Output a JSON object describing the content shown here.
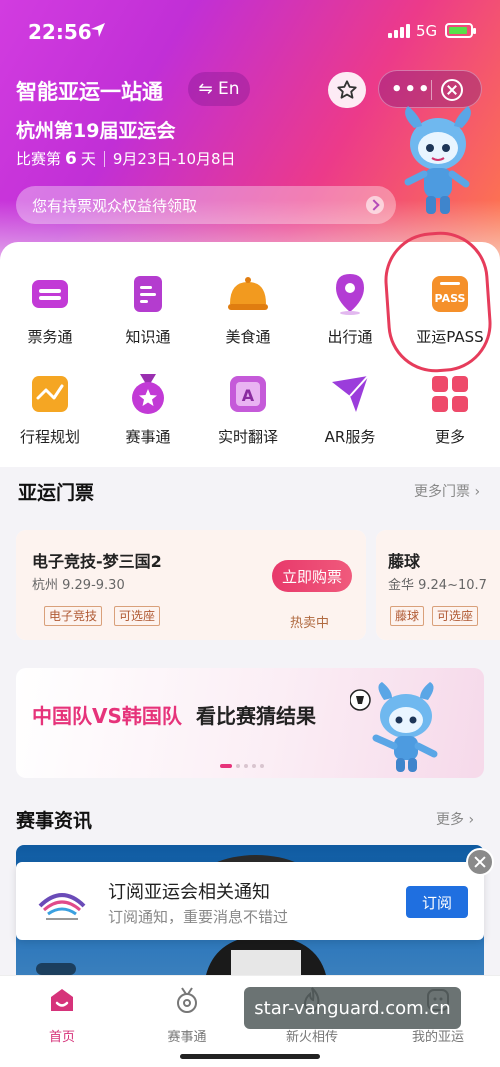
{
  "status_bar": {
    "time": "22:56",
    "network": "5G"
  },
  "header": {
    "app_title": "智能亚运一站通",
    "lang_label": "⇋ En",
    "games_title": "杭州第19届亚运会",
    "day_prefix": "比赛第",
    "day_number": "6",
    "day_suffix": "天",
    "dates": "9月23日-10月8日",
    "notice": "您有持票观众权益待领取"
  },
  "grid": [
    {
      "label": "票务通",
      "icon": "ticket-icon",
      "color": "#c23ad6"
    },
    {
      "label": "知识通",
      "icon": "document-icon",
      "color": "#b43ccf"
    },
    {
      "label": "美食通",
      "icon": "food-cover-icon",
      "color": "#f29a1f"
    },
    {
      "label": "出行通",
      "icon": "location-pin-icon",
      "color": "#b33cd4"
    },
    {
      "label": "亚运PASS",
      "icon": "pass-card-icon",
      "color": "#f5902a",
      "icon_text": "PASS"
    },
    {
      "label": "行程规划",
      "icon": "trip-chart-icon",
      "color": "#f5a623"
    },
    {
      "label": "赛事通",
      "icon": "medal-icon",
      "color": "#c23ad6"
    },
    {
      "label": "实时翻译",
      "icon": "translate-icon",
      "color": "#c55ad9",
      "icon_text": "A"
    },
    {
      "label": "AR服务",
      "icon": "ar-arrow-icon",
      "color": "#9b3ddb"
    },
    {
      "label": "更多",
      "icon": "more-grid-icon",
      "color": "#ee4a6a"
    }
  ],
  "tickets_section": {
    "title": "亚运门票",
    "more": "更多门票"
  },
  "tickets": [
    {
      "name": "电子竞技-梦三国2",
      "info": "杭州 9.29-9.30",
      "tags": [
        "电子竞技",
        "可选座"
      ],
      "buy_label": "立即购票",
      "status": "热卖中"
    },
    {
      "name": "藤球",
      "info": "金华 9.24~10.7",
      "tags": [
        "藤球",
        "可选座"
      ]
    }
  ],
  "banner": {
    "red_text": "中国队VS韩国队",
    "black_text": "看比赛猜结果"
  },
  "news_section": {
    "title": "赛事资讯",
    "more": "更多"
  },
  "subscribe": {
    "title": "订阅亚运会相关通知",
    "desc": "订阅通知，重要消息不错过",
    "button": "订阅"
  },
  "tabs": [
    {
      "label": "首页",
      "icon": "home-icon",
      "active": true
    },
    {
      "label": "赛事通",
      "icon": "medal-tab-icon"
    },
    {
      "label": "新火相传",
      "icon": "flame-icon"
    },
    {
      "label": "我的亚运",
      "icon": "profile-icon"
    }
  ],
  "watermark": "star-vanguard.com.cn",
  "colors": {
    "accent": "#e6337a",
    "brand_purple": "#c23ad6",
    "subscribe_blue": "#1f6fe0"
  }
}
